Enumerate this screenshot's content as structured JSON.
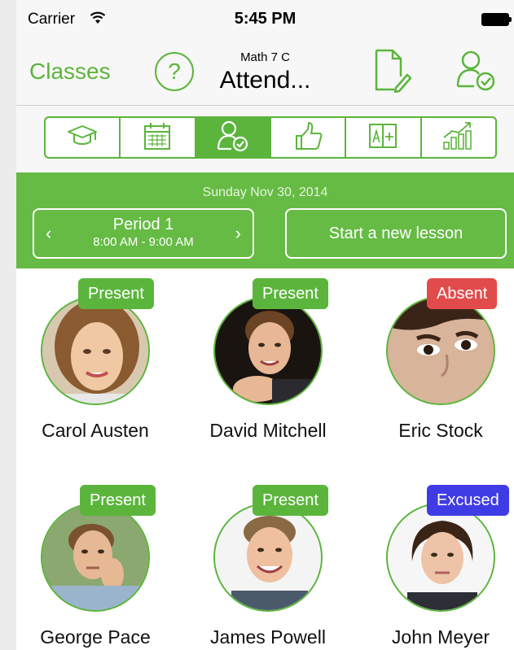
{
  "status_bar": {
    "carrier": "Carrier",
    "time": "5:45 PM"
  },
  "nav": {
    "back_label": "Classes",
    "help_label": "?",
    "subtitle": "Math 7 C",
    "title": "Attend..."
  },
  "tabs": [
    {
      "icon": "graduation-cap-icon",
      "active": false
    },
    {
      "icon": "calendar-icon",
      "active": false
    },
    {
      "icon": "person-check-icon",
      "active": true
    },
    {
      "icon": "thumbs-up-icon",
      "active": false
    },
    {
      "icon": "book-plus-icon",
      "active": false
    },
    {
      "icon": "bar-chart-icon",
      "active": false
    }
  ],
  "session": {
    "date": "Sunday Nov 30, 2014",
    "period_name": "Period 1",
    "period_time": "8:00 AM - 9:00 AM",
    "prev": "‹",
    "next": "›",
    "new_lesson_label": "Start a new lesson"
  },
  "students": [
    {
      "name": "Carol Austen",
      "status": "Present"
    },
    {
      "name": "David Mitchell",
      "status": "Present"
    },
    {
      "name": "Eric Stock",
      "status": "Absent"
    },
    {
      "name": "George Pace",
      "status": "Present"
    },
    {
      "name": "James Powell",
      "status": "Present"
    },
    {
      "name": "John Meyer",
      "status": "Excused"
    }
  ],
  "colors": {
    "accent": "#5bb53c",
    "band": "#66bb44",
    "absent": "#e24b4b",
    "excused": "#3f3ce6"
  }
}
